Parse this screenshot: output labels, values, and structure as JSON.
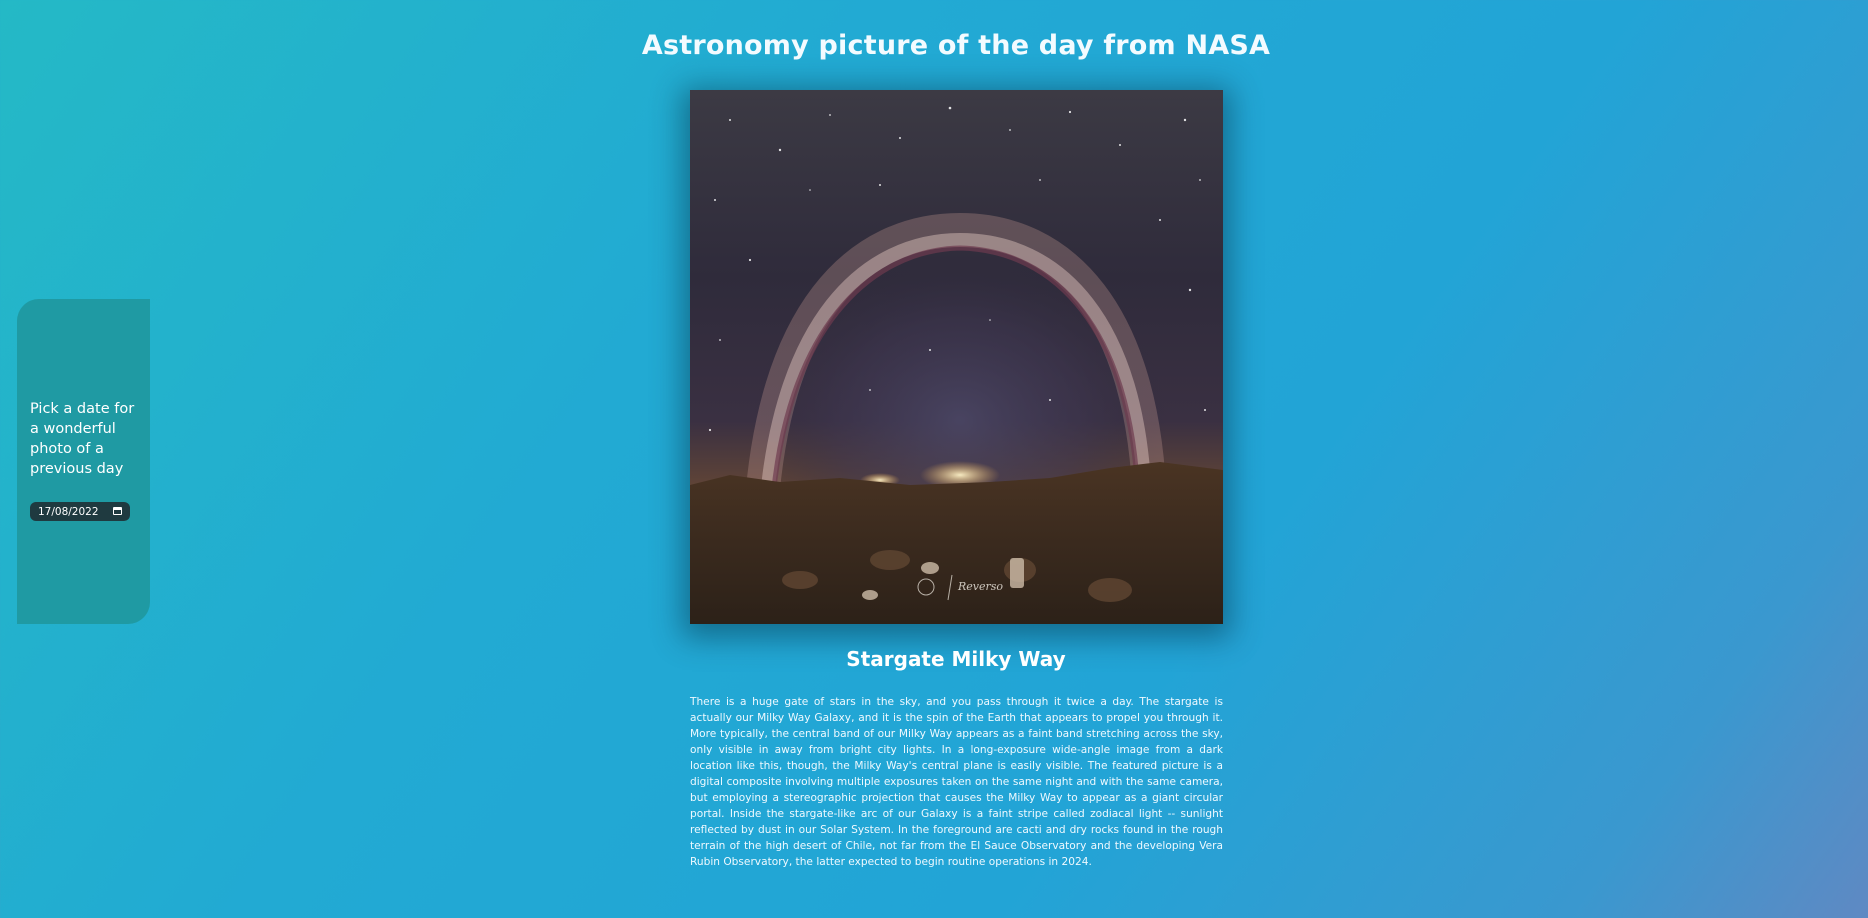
{
  "header": {
    "title": "Astronomy picture of the day from NASA"
  },
  "sidebar": {
    "prompt": "Pick a date for a wonderful photo of a previous day",
    "date_value": "17/08/2022",
    "calendar_icon": "calendar-icon"
  },
  "photo": {
    "watermark": "Reverso",
    "title": "Stargate Milky Way",
    "explanation": "There is a huge gate of stars in the sky, and you pass through it twice a day. The stargate is actually our Milky Way Galaxy, and it is the spin of the Earth that appears to propel you through it. More typically, the central band of our Milky Way appears as a faint band stretching across the sky, only visible in away from bright city lights. In a long-exposure wide-angle image from a dark location like this, though, the Milky Way's central plane is easily visible. The featured picture is a digital composite involving multiple exposures taken on the same night and with the same camera, but employing a stereographic projection that causes the Milky Way to appear as a giant circular portal. Inside the stargate-like arc of our Galaxy is a faint stripe called zodiacal light -- sunlight reflected by dust in our Solar System. In the foreground are cacti and dry rocks found in the rough terrain of the high desert of Chile, not far from the El Sauce Observatory and the developing Vera Rubin Observatory, the latter expected to begin routine operations in 2024."
  },
  "colors": {
    "background_start": "#24b9c6",
    "background_end": "#5f89c3",
    "sidebar": "#1f9aa3",
    "date_input": "#1f3a40"
  }
}
